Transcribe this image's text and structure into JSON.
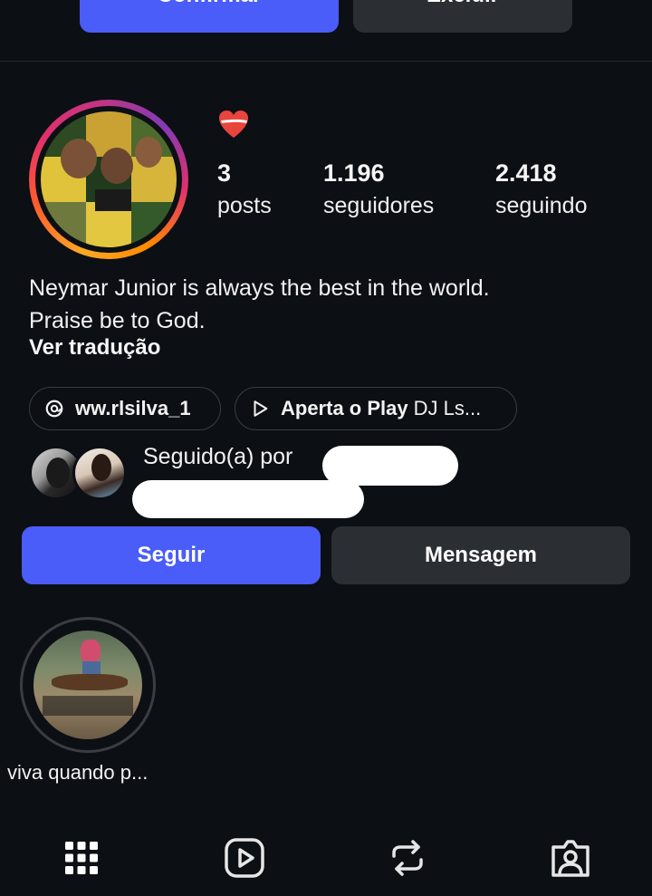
{
  "top_actions": {
    "confirm_label": "Confirmar",
    "delete_label": "Excluir"
  },
  "profile": {
    "emoji": "heart",
    "stats": [
      {
        "value": "3",
        "label": "posts"
      },
      {
        "value": "1.196",
        "label": "seguidores"
      },
      {
        "value": "2.418",
        "label": "seguindo"
      }
    ],
    "bio_line1": "Neymar Junior is always the best in the world.",
    "bio_line2": "Praise be to God.",
    "translate_label": "Ver tradução",
    "links": {
      "threads_handle": "ww.rlsilva_1",
      "music_bold": "Aperta o Play",
      "music_rest": "DJ Ls..."
    },
    "followed_by": "Seguido(a) por"
  },
  "actions": {
    "follow_label": "Seguir",
    "message_label": "Mensagem"
  },
  "highlights": [
    {
      "label": "viva quando p..."
    }
  ],
  "tabs": [
    "grid-icon",
    "reels-icon",
    "reposts-icon",
    "tagged-icon"
  ],
  "colors": {
    "accent": "#4a5df9",
    "background": "#0c0f14",
    "secondary_button": "#2b2e33"
  }
}
